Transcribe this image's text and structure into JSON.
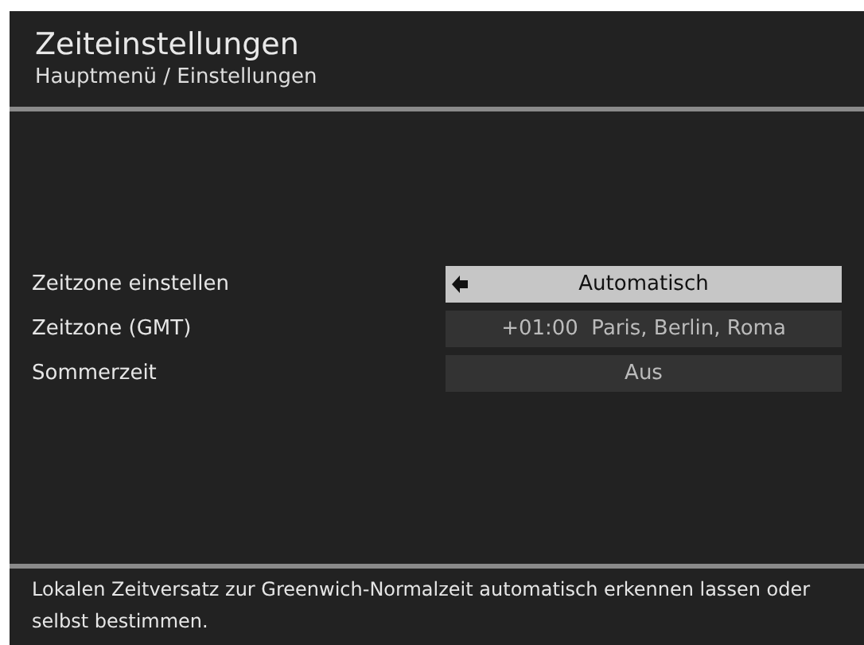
{
  "header": {
    "title": "Zeiteinstellungen",
    "breadcrumb": "Hauptmenü / Einstellungen"
  },
  "settings": [
    {
      "label": "Zeitzone einstellen",
      "value": "Automatisch",
      "selected": true
    },
    {
      "label": "Zeitzone (GMT)",
      "value": "+01:00  Paris, Berlin, Roma",
      "selected": false
    },
    {
      "label": "Sommerzeit",
      "value": "Aus",
      "selected": false
    }
  ],
  "help_text": "Lokalen Zeitversatz zur Greenwich-Normalzeit automatisch erkennen lassen oder selbst bestimmen."
}
